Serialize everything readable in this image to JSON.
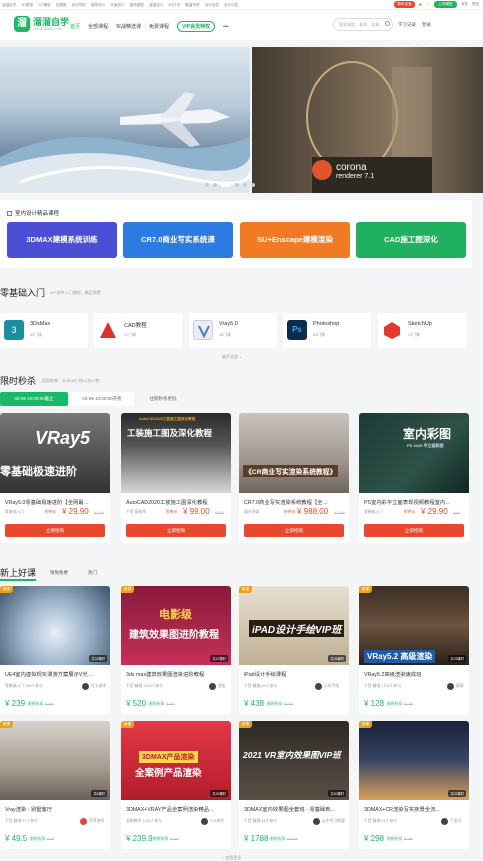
{
  "topbar": {
    "left": [
      "溜溜自学",
      "3D模型",
      "CG模型",
      "效果图",
      "设计导航",
      "建筑设计",
      "平面设计",
      "建筑模型",
      "溜溜设计",
      "3D打印",
      "酷溜学院",
      "设计创意",
      "设计问答"
    ],
    "right_badge": "新年优惠",
    "right_upload": "上传模型",
    "right_links": [
      "消息",
      "登录"
    ]
  },
  "header": {
    "logo_text": "溜溜自学",
    "logo_sub": "ZIXUE.3D66.COM",
    "nav": [
      "首页",
      "全部课程",
      "实战精选课",
      "免费课程"
    ],
    "vip": "VIP会员特权",
    "more": "•••",
    "search_placeholder": "搜索课程、老师、文章",
    "right": [
      "学习记录",
      "登录"
    ]
  },
  "banner": {
    "slide2_brand": "corona",
    "slide2_sub": "renderer 7.1"
  },
  "courses": {
    "title": "室内设计精品课程",
    "buttons": [
      {
        "label": "3DMAX建模系统训练",
        "color": "#4a4fd6"
      },
      {
        "label": "CR7.0商业写实系统课",
        "color": "#2b7be0"
      },
      {
        "label": "SU+Enscape建模渲染",
        "color": "#f07b24"
      },
      {
        "label": "CAD施工图深化",
        "color": "#21b060"
      }
    ]
  },
  "zero": {
    "title": "零基础入门",
    "sub": "44+软件入门课程，精品免费",
    "cats": [
      {
        "name": "3DsMax",
        "count": "89门课",
        "color": "#1a8fa0"
      },
      {
        "name": "CAD教程",
        "count": "27门课",
        "color": "#d8322b"
      },
      {
        "name": "Vray5.0",
        "count": "49门课",
        "color": "#eaeef3"
      },
      {
        "name": "Photoshop",
        "count": "83门课",
        "color": "#0d2b4d"
      },
      {
        "name": "SketchUp",
        "count": "27门课",
        "color": "#e33a2d"
      }
    ],
    "more": "展开全部"
  },
  "flash": {
    "title": "限时秒杀",
    "sub": "距离结束：05天00小时12分27秒",
    "tabs": [
      "03-09 10:00:00截止",
      "03-09 10:00:00开抢",
      "往期秒杀更低"
    ],
    "buy": "立即抢购",
    "cards": [
      {
        "title": "VRay5.0零基础极速进阶【全网最…",
        "meta": "零基础入门",
        "price": "¥ 29.90",
        "old": "¥ 6.99",
        "label": "秒杀价"
      },
      {
        "title": "AutoCAD2020工装施工图深化教程",
        "meta": "干货  高效率",
        "price": "¥ 99.00",
        "old": "¥ 369",
        "label": "秒杀价"
      },
      {
        "title": "CR7.0商业写实渲染系统教程【全…",
        "meta": "通关答疑",
        "price": "¥ 988.00",
        "old": "¥ 1999",
        "label": "秒杀价"
      },
      {
        "title": "PS室内彩平立面表现视频教程室内…",
        "meta": "零基础入门",
        "price": "¥ 29.90",
        "old": "¥ 99",
        "label": "秒杀价"
      }
    ],
    "thumbs": [
      "VRay5",
      "零基础极速进阶",
      "AutoCAD2020工装施工图深化教程",
      "工装施工图及深化教程",
      "《CR商业写实渲染系统教程》",
      "室内彩图",
      "PS 2020 平立面彩图"
    ]
  },
  "newcourses": {
    "title": "新上好课",
    "tabs": [
      "限免免费",
      "热门"
    ],
    "cards": [
      {
        "title": "UE4室内虚拟现实漫游方案展示V光…",
        "meta": "零基础入门  109人参与",
        "price": "¥ 239",
        "old": "¥ 299",
        "label": "限时折扣",
        "author": "旺卡老师",
        "tag": "新课",
        "duration": "共30课时"
      },
      {
        "title": "3ds max建筑效果图渲染进阶教程",
        "meta": "干货  精细  1782人参与",
        "price": "¥ 520",
        "old": "¥ 699",
        "label": "限时折扣",
        "author": "张宏",
        "tag": "新课",
        "duration": "共47课时"
      },
      {
        "title": "iPad设计手绘课程",
        "meta": "干货  精细  69人参与",
        "price": "¥ 438",
        "old": "¥ 688",
        "label": "限时折扣",
        "author": "小米手绘",
        "tag": "新课",
        "duration": "共36课时"
      },
      {
        "title": "VRay5.2高级渲染速成班",
        "meta": "干货  精细  1702人参与",
        "price": "¥ 128",
        "old": "¥ 158",
        "label": "限时折扣",
        "author": "薇薇",
        "tag": "新课",
        "duration": "共25课时"
      },
      {
        "title": "Vray渲染 - 别墅客厅",
        "meta": "干货  精细  97人参与",
        "price": "¥ 49.5",
        "old": "¥ 99",
        "label": "限时折扣",
        "author": "萍萍老师",
        "tag": "新课",
        "duration": "共8课时"
      },
      {
        "title": "3DMAX+VRAY产品全案例渲染精品…",
        "meta": "全新教学  1781人参与",
        "price": "¥ 239.9",
        "old": "¥ 299",
        "label": "限时折扣",
        "author": "小K老师",
        "tag": "新课",
        "duration": "共30课时"
      },
      {
        "title": "3DMAX室内效果图全套班 - 零基础到…",
        "meta": "干货  精细  44人参与",
        "price": "¥ 1788",
        "old": "¥ 1998",
        "label": "限时折扣",
        "author": "云中学习联盟",
        "tag": "新课",
        "duration": "共50课时"
      },
      {
        "title": "3DMAX+CR渲染写实夜景全流…",
        "meta": "干货  精细  91人参与",
        "price": "¥ 298",
        "old": "¥ 398",
        "label": "限时折扣",
        "author": "千里马",
        "tag": "新课",
        "duration": "共32课时"
      }
    ],
    "thumbs": [
      "电影级",
      "建筑效果图进阶教程",
      "iPAD设计手绘VIP班",
      "VRay5.2 高级渲染",
      "3DMAX产品渲染",
      "全案例产品渲染",
      "2021 VR室内效果图VIP班"
    ]
  },
  "footer": "查看更多"
}
